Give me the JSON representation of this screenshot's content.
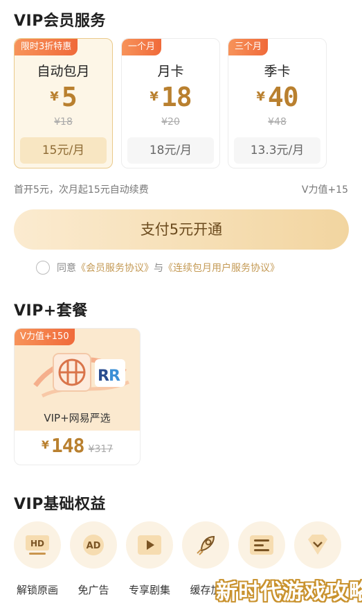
{
  "vip_section": {
    "title": "VIP会员服务",
    "plans": [
      {
        "badge": "限时3折特惠",
        "name": "自动包月",
        "currency": "¥",
        "price": "5",
        "original_price": "¥18",
        "monthly": "15元/月",
        "selected": true
      },
      {
        "badge": "一个月",
        "name": "月卡",
        "currency": "¥",
        "price": "18",
        "original_price": "¥20",
        "monthly": "18元/月",
        "selected": false
      },
      {
        "badge": "三个月",
        "name": "季卡",
        "currency": "¥",
        "price": "40",
        "original_price": "¥48",
        "monthly": "13.3元/月",
        "selected": false
      }
    ],
    "renew_note": "首开5元，次月起15元自动续费",
    "vpower_note": "V力值+15",
    "pay_button": "支付5元开通",
    "agreement": {
      "prefix": "同意",
      "link1": "《会员服务协议》",
      "connector": "与",
      "link2": "《连续包月用户服务协议》"
    }
  },
  "bundle_section": {
    "title": "VIP+套餐",
    "card": {
      "badge": "V力值+150",
      "name": "VIP+网易严选",
      "currency": "¥",
      "price": "148",
      "original_price": "¥317"
    }
  },
  "benefits_section": {
    "title": "VIP基础权益",
    "items": [
      {
        "label": "解锁原画",
        "icon": "hd-icon",
        "glyph": "HD"
      },
      {
        "label": "免广告",
        "icon": "ad-free-icon",
        "glyph": "AD"
      },
      {
        "label": "专享剧集",
        "icon": "play-icon",
        "glyph": ""
      },
      {
        "label": "缓存加",
        "icon": "rocket-icon",
        "glyph": ""
      },
      {
        "label": "",
        "icon": "list-icon",
        "glyph": ""
      },
      {
        "label": "",
        "icon": "diamond-icon",
        "glyph": ""
      }
    ]
  },
  "watermark": "新时代游戏攻略",
  "colors": {
    "accent": "#b9802f",
    "badge": "#f06a3a",
    "link": "#c49a55",
    "pay_button": "#f2d5a0"
  }
}
